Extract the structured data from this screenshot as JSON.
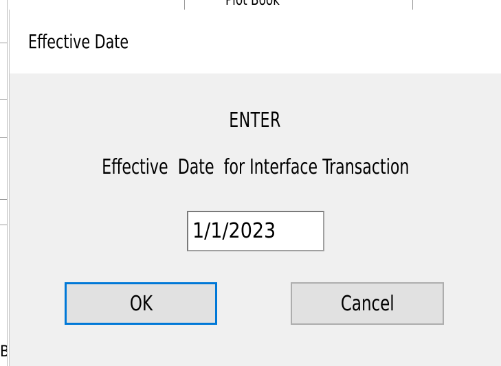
{
  "background": {
    "top_text": "Plot Book",
    "left_char": "B"
  },
  "dialog": {
    "title": "Effective Date",
    "heading": "ENTER",
    "prompt": "Effective  Date  for Interface Transaction",
    "date_value": "1/1/2023",
    "ok_label": "OK",
    "cancel_label": "Cancel"
  },
  "colors": {
    "focus_border": "#0078d7",
    "dialog_bg": "#f0f0f0",
    "button_bg": "#e1e1e1"
  }
}
